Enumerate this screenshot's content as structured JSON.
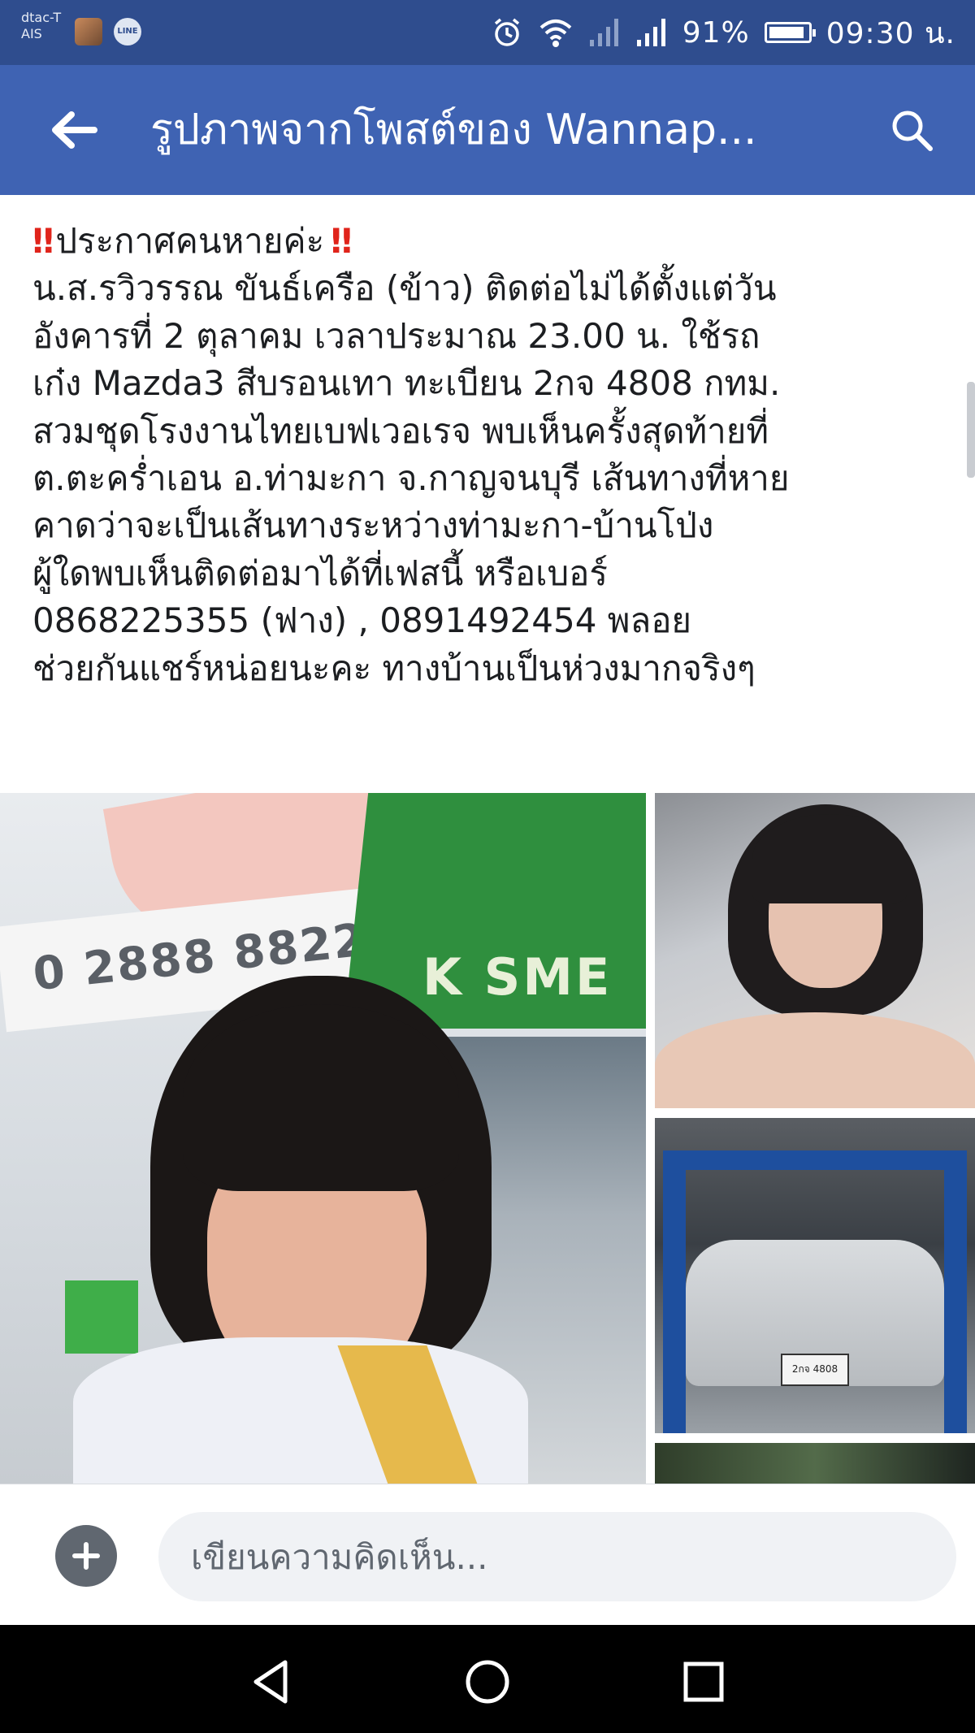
{
  "status_bar": {
    "carrier_line1": "dtac-T",
    "carrier_line2": "AIS",
    "line_app_label": "LINE",
    "battery_percent": "91%",
    "battery_level": 0.91,
    "time": "09:30 น.",
    "icons": [
      "alarm-icon",
      "wifi-icon",
      "signal-icon",
      "signal-icon",
      "battery-icon"
    ]
  },
  "app_bar": {
    "title": "รูปภาพจากโพสต์ของ Wannap...",
    "back_icon": "arrow-left-icon",
    "search_icon": "search-icon",
    "color": "#3f63b3"
  },
  "post": {
    "title_mark": "‼",
    "title": "ประกาศคนหายค่ะ",
    "lines": [
      "น.ส.รวิวรรณ  ขันธ์เครือ (ข้าว) ติดต่อไม่ได้ตั้งแต่วัน",
      "อังคารที่ 2 ตุลาคม เวลาประมาณ 23.00 น. ใช้รถ",
      "เก๋ง Mazda3 สีบรอนเทา ทะเบียน 2กจ 4808 กทม.",
      "สวมชุดโรงงานไทยเบฟเวอเรจ พบเห็นครั้งสุดท้ายที่",
      "ต.ตะคร่ำเอน อ.ท่ามะกา จ.กาญจนบุรี เส้นทางที่หาย",
      "คาดว่าจะเป็นเส้นทางระหว่างท่ามะกา-บ้านโป่ง",
      "ผู้ใดพบเห็นติดต่อมาได้ที่เฟสนี้ หรือเบอร์",
      "0868225355 (ฟาง) , 0891492454 พลอย",
      "ช่วยกันแชร์หน่อยนะคะ ทางบ้านเป็นห่วงมากจริงๆ"
    ]
  },
  "photos": {
    "main_sign_text": "0 2888 8822",
    "main_umbrella_text": "K SME",
    "car_plate_text": "2กจ 4808"
  },
  "comment": {
    "placeholder": "เขียนความคิดเห็น...",
    "value": "",
    "add_icon": "plus-icon"
  },
  "nav": {
    "icons": [
      "nav-back-icon",
      "nav-home-icon",
      "nav-recent-icon"
    ]
  }
}
